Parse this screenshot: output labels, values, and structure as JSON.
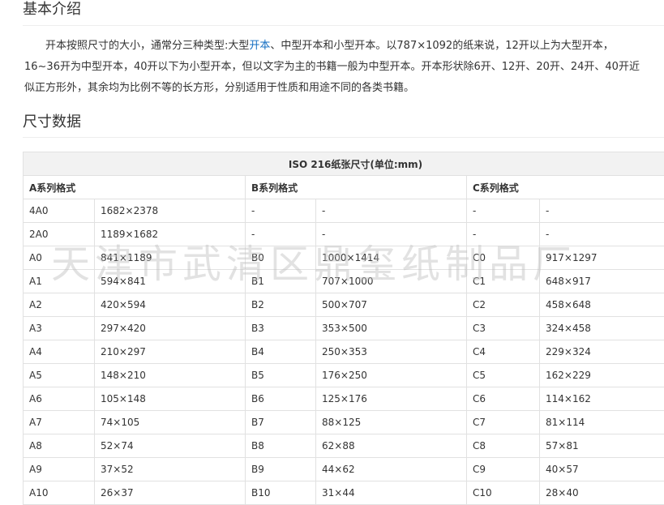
{
  "intro": {
    "heading": "基本介绍",
    "line1_before_link": "开本按照尺寸的大小，通常分三种类型:大型",
    "line1_link": "开本",
    "line1_after_link": "、中型开本和小型开本。以787×1092的纸来说，12开以上为大型开本，",
    "line2": "16~36开为中型开本，40开以下为小型开本，但以文字为主的书籍一般为中型开本。开本形状除6开、12开、20开、24开、40开近",
    "line3": "似正方形外，其余均为比例不等的长方形，分别适用于性质和用途不同的各类书籍。"
  },
  "size": {
    "heading": "尺寸数据"
  },
  "table": {
    "title": "ISO 216纸张尺寸(单位:mm)",
    "groups": [
      "A系列格式",
      "B系列格式",
      "C系列格式"
    ],
    "rows": [
      [
        "4A0",
        "1682×2378",
        "-",
        "-",
        "-",
        "-"
      ],
      [
        "2A0",
        "1189×1682",
        "-",
        "-",
        "-",
        "-"
      ],
      [
        "A0",
        "841×1189",
        "B0",
        "1000×1414",
        "C0",
        "917×1297"
      ],
      [
        "A1",
        "594×841",
        "B1",
        "707×1000",
        "C1",
        "648×917"
      ],
      [
        "A2",
        "420×594",
        "B2",
        "500×707",
        "C2",
        "458×648"
      ],
      [
        "A3",
        "297×420",
        "B3",
        "353×500",
        "C3",
        "324×458"
      ],
      [
        "A4",
        "210×297",
        "B4",
        "250×353",
        "C4",
        "229×324"
      ],
      [
        "A5",
        "148×210",
        "B5",
        "176×250",
        "C5",
        "162×229"
      ],
      [
        "A6",
        "105×148",
        "B6",
        "125×176",
        "C6",
        "114×162"
      ],
      [
        "A7",
        "74×105",
        "B7",
        "88×125",
        "C7",
        "81×114"
      ],
      [
        "A8",
        "52×74",
        "B8",
        "62×88",
        "C8",
        "57×81"
      ],
      [
        "A9",
        "37×52",
        "B9",
        "44×62",
        "C9",
        "40×57"
      ],
      [
        "A10",
        "26×37",
        "B10",
        "31×44",
        "C10",
        "28×40"
      ]
    ]
  },
  "watermark": "天津市武清区鼎玺纸制品厂",
  "colors": {
    "link": "#136ec2",
    "text": "#333333",
    "border": "#e1e1e1",
    "header_bg": "#f2f2f2"
  }
}
